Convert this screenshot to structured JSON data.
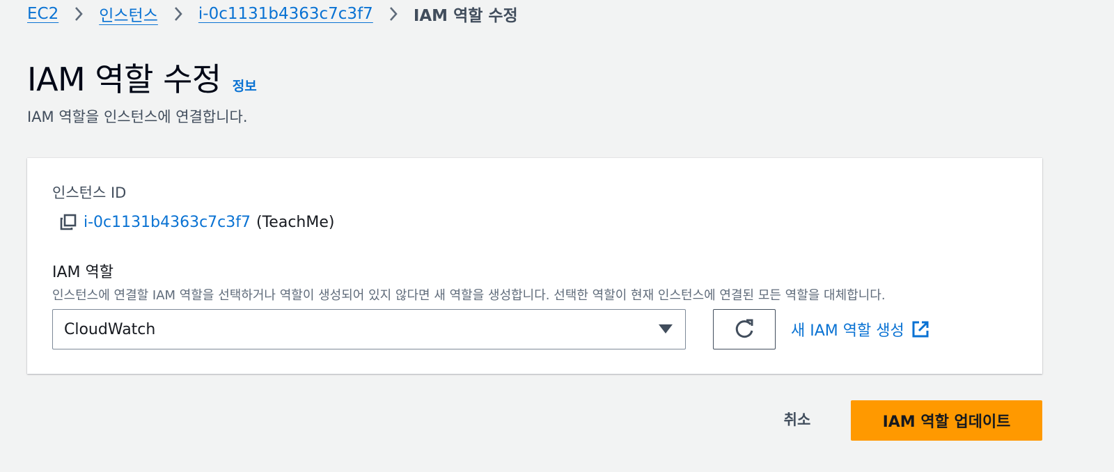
{
  "breadcrumb": {
    "items": [
      {
        "label": "EC2"
      },
      {
        "label": "인스턴스"
      },
      {
        "label": "i-0c1131b4363c7c3f7"
      }
    ],
    "current": "IAM 역할 수정"
  },
  "page": {
    "title": "IAM 역할 수정",
    "info_link": "정보",
    "description": "IAM 역할을 인스턴스에 연결합니다."
  },
  "panel": {
    "instance_id_label": "인스턴스 ID",
    "instance_id": "i-0c1131b4363c7c3f7",
    "instance_name": "(TeachMe)",
    "iam_role_label": "IAM 역할",
    "iam_role_description": "인스턴스에 연결할 IAM 역할을 선택하거나 역할이 생성되어 있지 않다면 새 역할을 생성합니다. 선택한 역할이 현재 인스턴스에 연결된 모든 역할을 대체합니다.",
    "selected_role": "CloudWatch",
    "create_role_link": "새 IAM 역할 생성"
  },
  "actions": {
    "cancel": "취소",
    "update": "IAM 역할 업데이트"
  },
  "icons": {
    "separator": "chevron-right-icon",
    "copy": "copy-icon",
    "dropdown": "caret-down-icon",
    "refresh": "refresh-icon",
    "external": "external-link-icon"
  },
  "colors": {
    "link": "#0972d3",
    "primary_button": "#ff9900",
    "background": "#f2f3f3"
  }
}
